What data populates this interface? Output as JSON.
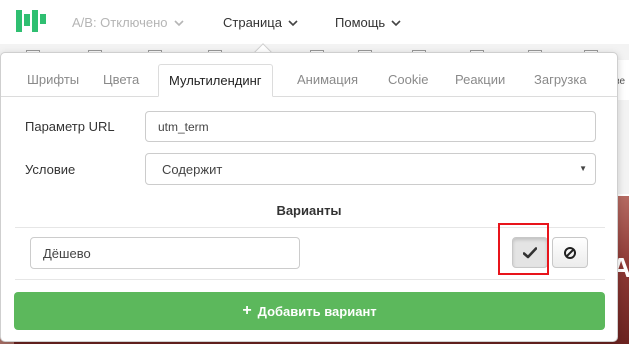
{
  "topbar": {
    "ab_label": "A/B: Отключено",
    "page_label": "Страница",
    "help_label": "Помощь"
  },
  "background": {
    "right_fragment": "зе",
    "photo_letter": "А"
  },
  "tabs": [
    {
      "label": "Шрифты",
      "active": false
    },
    {
      "label": "Цвета",
      "active": false
    },
    {
      "label": "Мультилендинг",
      "active": true
    },
    {
      "label": "Анимация",
      "active": false
    },
    {
      "label": "Cookie",
      "active": false
    },
    {
      "label": "Реакции",
      "active": false
    },
    {
      "label": "Загрузка",
      "active": false
    }
  ],
  "form": {
    "url_param_label": "Параметр URL",
    "url_param_value": "utm_term",
    "condition_label": "Условие",
    "condition_value": "Содержит",
    "variants_title": "Варианты",
    "variant_value": "Дёшево",
    "add_variant_label": "Добавить вариант"
  },
  "colors": {
    "accent_green": "#5cb85c",
    "highlight_red": "#e8141b",
    "logo_green": "#2fbf71"
  },
  "icons": {
    "confirm": "checkmark-icon",
    "cancel": "ban-icon"
  }
}
